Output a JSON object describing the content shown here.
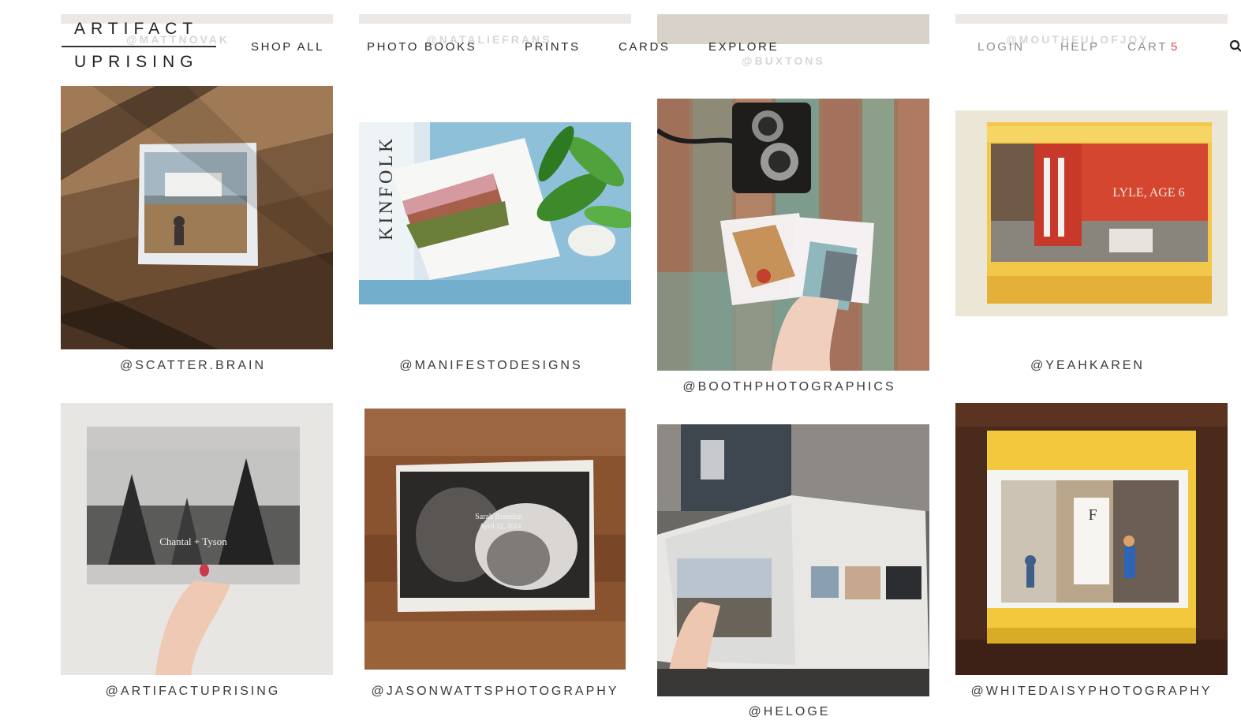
{
  "brand": {
    "line1": "ARTIFACT",
    "line2": "UPRISING"
  },
  "nav": {
    "shop_all": "SHOP ALL",
    "photo_books": "PHOTO BOOKS",
    "prints": "PRINTS",
    "cards": "CARDS",
    "explore": "EXPLORE"
  },
  "utility": {
    "login": "LOGIN",
    "help": "HELP",
    "cart_label": "CART",
    "cart_count": "5",
    "search_icon": "search-icon"
  },
  "ghost_handles": {
    "col1": "@MATTNOVAK",
    "col2": "@NATALIEFRANS",
    "col3": "@BUXTONS",
    "col4": "@MOUTHFULOFJOY"
  },
  "grid": [
    {
      "handle": "@SCATTER.BRAIN"
    },
    {
      "handle": "@MANIFESTODESIGNS"
    },
    {
      "handle": "@BOOTHPHOTOGRAPHICS"
    },
    {
      "handle": "@YEAHKAREN"
    },
    {
      "handle": "@ARTIFACTUPRISING"
    },
    {
      "handle": "@JASONWATTSPHOTOGRAPHY"
    },
    {
      "handle": "@HELOGE"
    },
    {
      "handle": "@WHITEDAISYPHOTOGRAPHY"
    }
  ],
  "photo_text": {
    "kinfolk": "KINFOLK",
    "lyle": "LYLE, AGE 6",
    "chantal": "Chantal + Tyson",
    "couple_names": "Sarah Brandon",
    "couple_date": "April 12, 2014",
    "book_letter": "F"
  },
  "colors": {
    "cart_count": "#e0474c",
    "nav_dark": "#2b2b2b",
    "nav_light": "#8c8c8c"
  }
}
